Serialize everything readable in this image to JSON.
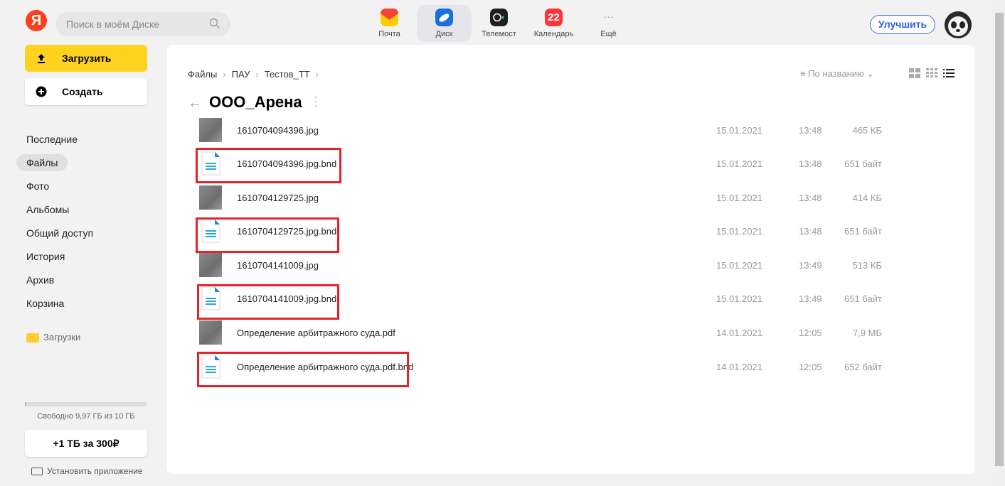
{
  "header": {
    "logo_letter": "Я",
    "search_placeholder": "Поиск в моём Диске",
    "services": [
      {
        "label": "Почта",
        "color": "#f5423b",
        "icon": "mail-icon"
      },
      {
        "label": "Диск",
        "color": "#1870dc",
        "icon": "disk-icon",
        "active": true
      },
      {
        "label": "Телемост",
        "color": "#1f1f1f",
        "icon": "telemost-icon"
      },
      {
        "label": "Календарь",
        "color": "#f33",
        "icon": "calendar-icon",
        "badge": "22"
      },
      {
        "label": "Ещё",
        "icon": "more-dots-icon"
      }
    ],
    "upgrade_label": "Улучшить"
  },
  "sidebar": {
    "upload_label": "Загрузить",
    "create_label": "Создать",
    "items": [
      {
        "label": "Последние"
      },
      {
        "label": "Файлы",
        "active": true
      },
      {
        "label": "Фото"
      },
      {
        "label": "Альбомы"
      },
      {
        "label": "Общий доступ"
      },
      {
        "label": "История"
      },
      {
        "label": "Архив"
      },
      {
        "label": "Корзина"
      }
    ],
    "folder_label": "Загрузки",
    "storage_text": "Свободно 9,97 ГБ из 10 ГБ",
    "storage_used_fraction": 0.003,
    "tb_offer": "+1 ТБ за 300₽",
    "install_label": "Установить приложение"
  },
  "main": {
    "breadcrumb": [
      "Файлы",
      "ПАУ",
      "Тестов_ТТ"
    ],
    "breadcrumb_sep": "›",
    "title": "ООО_Арена",
    "sort_label": "По названию",
    "files": [
      {
        "name": "1610704094396.jpg",
        "date": "15.01.2021",
        "time": "13:48",
        "size": "465 КБ",
        "type": "image"
      },
      {
        "name": "1610704094396.jpg.bnd",
        "date": "15.01.2021",
        "time": "13:48",
        "size": "651 байт",
        "type": "doc"
      },
      {
        "name": "1610704129725.jpg",
        "date": "15.01.2021",
        "time": "13:48",
        "size": "414 КБ",
        "type": "image"
      },
      {
        "name": "1610704129725.jpg.bnd",
        "date": "15.01.2021",
        "time": "13:48",
        "size": "651 байт",
        "type": "doc"
      },
      {
        "name": "1610704141009.jpg",
        "date": "15.01.2021",
        "time": "13:49",
        "size": "513 КБ",
        "type": "image"
      },
      {
        "name": "1610704141009.jpg.bnd",
        "date": "15.01.2021",
        "time": "13:49",
        "size": "651 байт",
        "type": "doc"
      },
      {
        "name": "Определение арбитражного суда.pdf",
        "date": "14.01.2021",
        "time": "12:05",
        "size": "7,9 МБ",
        "type": "image"
      },
      {
        "name": "Определение арбитражного суда.pdf.bnd",
        "date": "14.01.2021",
        "time": "12:05",
        "size": "652 байт",
        "type": "doc"
      }
    ]
  },
  "colors": {
    "highlight": "#e8222b",
    "accent": "#ffd21f"
  }
}
